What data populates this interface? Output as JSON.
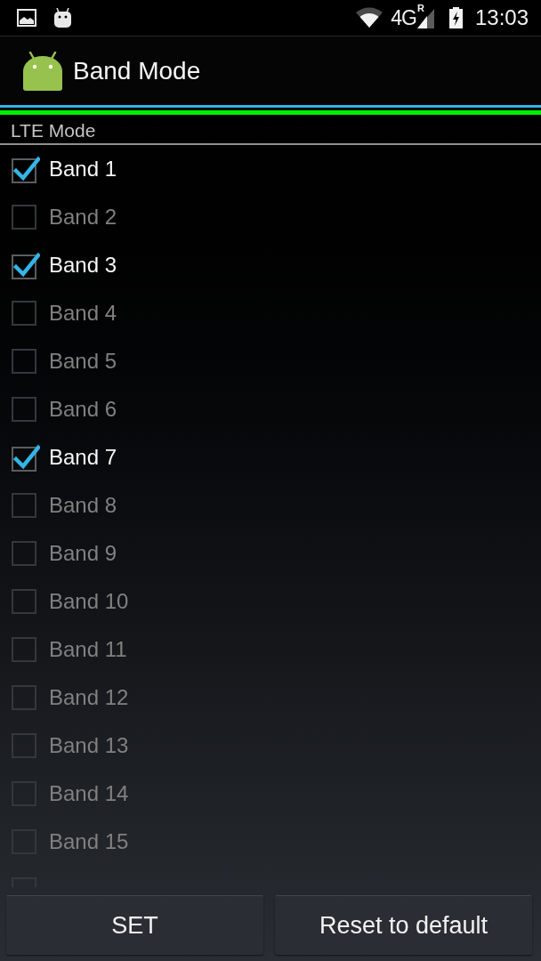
{
  "status_bar": {
    "network": "4G",
    "roaming": "R",
    "time": "13:03"
  },
  "action_bar": {
    "title": "Band Mode"
  },
  "section": {
    "title": "LTE Mode"
  },
  "bands": [
    {
      "label": "Band 1",
      "checked": true
    },
    {
      "label": "Band 2",
      "checked": false
    },
    {
      "label": "Band 3",
      "checked": true
    },
    {
      "label": "Band 4",
      "checked": false
    },
    {
      "label": "Band 5",
      "checked": false
    },
    {
      "label": "Band 6",
      "checked": false
    },
    {
      "label": "Band 7",
      "checked": true
    },
    {
      "label": "Band 8",
      "checked": false
    },
    {
      "label": "Band 9",
      "checked": false
    },
    {
      "label": "Band 10",
      "checked": false
    },
    {
      "label": "Band 11",
      "checked": false
    },
    {
      "label": "Band 12",
      "checked": false
    },
    {
      "label": "Band 13",
      "checked": false
    },
    {
      "label": "Band 14",
      "checked": false
    },
    {
      "label": "Band 15",
      "checked": false
    },
    {
      "checked": false
    }
  ],
  "buttons": [
    "SET",
    "Reset to default"
  ]
}
